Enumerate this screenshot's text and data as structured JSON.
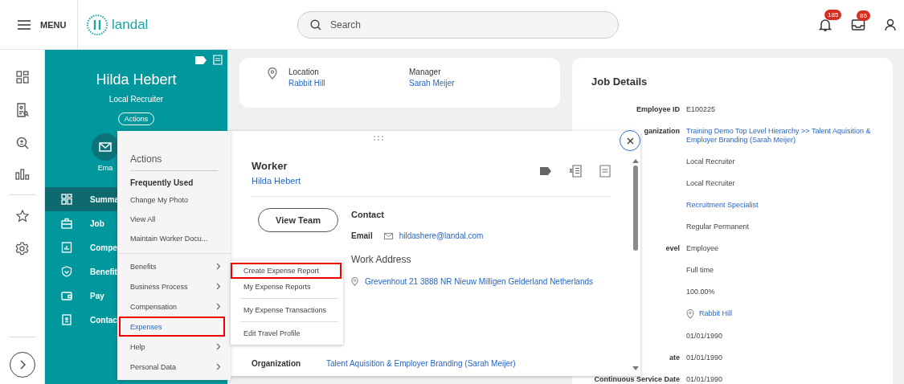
{
  "header": {
    "menu_label": "MENU",
    "logo_text": "landal",
    "search": {
      "placeholder": "Search"
    },
    "notifications": "185",
    "inbox": "86"
  },
  "profile": {
    "name": "Hilda Hebert",
    "title": "Local Recruiter",
    "actions_label": "Actions",
    "email_label": "Ema",
    "nav": [
      {
        "label": "Summa",
        "kind": "grid",
        "selected": true
      },
      {
        "label": "Job",
        "kind": "briefcase",
        "selected": false
      },
      {
        "label": "Compe",
        "kind": "chart",
        "selected": false
      },
      {
        "label": "Benefit",
        "kind": "shield",
        "selected": false
      },
      {
        "label": "Pay",
        "kind": "wallet",
        "selected": false
      },
      {
        "label": "Contac",
        "kind": "contact",
        "selected": false
      }
    ]
  },
  "summary_card": {
    "fields": [
      {
        "label": "Location",
        "value": "Rabbit Hill",
        "pin": true
      },
      {
        "label": "Manager",
        "value": "Sarah Meijer",
        "pin": false
      }
    ]
  },
  "job_details": {
    "title": "Job Details",
    "rows": [
      {
        "label": "Employee ID",
        "value": "E100225",
        "link": false,
        "pin": false
      },
      {
        "label": "ganization",
        "value": "Training Demo Top Level Hierarchy >> Talent Aquisition & Employer Branding (Sarah Meijer)",
        "link": true,
        "pin": false
      },
      {
        "value": "Local Recruiter",
        "link": false,
        "pin": false
      },
      {
        "value": "Local Recruiter",
        "link": false,
        "pin": false
      },
      {
        "value": "Recruitment Specialist",
        "link": true,
        "pin": false
      },
      {
        "value": "Regular Permanent",
        "link": false,
        "pin": false
      },
      {
        "label": "evel",
        "value": "Employee",
        "link": false,
        "pin": false
      },
      {
        "value": "Full time",
        "link": false,
        "pin": false
      },
      {
        "value": "100.00%",
        "link": false,
        "pin": false
      },
      {
        "value": "Rabbit Hill",
        "link": true,
        "pin": true
      },
      {
        "value": "01/01/1990",
        "link": false,
        "pin": false
      },
      {
        "label": "ate",
        "value": "01/01/1990",
        "link": false,
        "pin": false
      },
      {
        "label": "Continuous Service Date",
        "value": "01/01/1990",
        "link": false,
        "pin": false
      }
    ]
  },
  "actions_menu": {
    "title": "Actions",
    "section": "Frequently Used",
    "frequent": [
      "Change My Photo",
      "View All",
      "Maintain Worker Docu..."
    ],
    "categories": [
      {
        "label": "Benefits",
        "expanded": false,
        "highlighted": false
      },
      {
        "label": "Business Process",
        "expanded": false,
        "highlighted": false
      },
      {
        "label": "Compensation",
        "expanded": false,
        "highlighted": false
      },
      {
        "label": "Expenses",
        "expanded": true,
        "highlighted": true
      },
      {
        "label": "Help",
        "expanded": false,
        "highlighted": false
      },
      {
        "label": "Personal Data",
        "expanded": false,
        "highlighted": false
      }
    ]
  },
  "submenu": {
    "groups": [
      [
        {
          "label": "Create Expense Report",
          "highlighted": true
        },
        {
          "label": "My Expense Reports",
          "highlighted": false
        }
      ],
      [
        {
          "label": "My Expense Transactions",
          "highlighted": false
        }
      ],
      [
        {
          "label": "Edit Travel Profile",
          "highlighted": false
        }
      ]
    ]
  },
  "worker_popup": {
    "title": "Worker",
    "name": "Hilda Hebert",
    "view_team": "View Team",
    "contact_title": "Contact",
    "email_label": "Email",
    "email": "hildashere@landal.com",
    "address_title": "Work Address",
    "address": "Grevenhout 21 3888 NR Nieuw Milligen Gelderland Netherlands",
    "organization_label": "Organization",
    "organization": "Talent Aquisition & Employer Branding (Sarah Meijer)"
  }
}
